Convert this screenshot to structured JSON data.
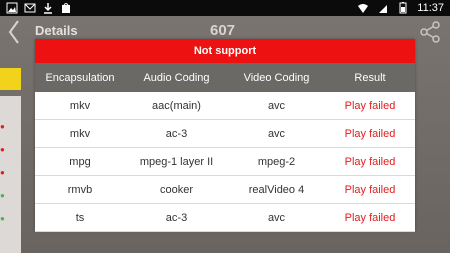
{
  "status_bar": {
    "time": "11:37",
    "left_icons": [
      "image-icon",
      "gmail-icon",
      "download-icon",
      "store-icon"
    ],
    "right_icons": [
      "wifi-icon",
      "sim-icon",
      "battery-icon"
    ]
  },
  "app": {
    "title": "Details",
    "number": "607"
  },
  "dialog": {
    "title": "Not support",
    "headers": [
      "Encapsulation",
      "Audio Coding",
      "Video Coding",
      "Result"
    ],
    "rows": [
      [
        "mkv",
        "aac(main)",
        "avc",
        "Play failed"
      ],
      [
        "mkv",
        "ac-3",
        "avc",
        "Play failed"
      ],
      [
        "mpg",
        "mpeg-1 layer II",
        "mpeg-2",
        "Play failed"
      ],
      [
        "rmvb",
        "cooker",
        "realVideo 4",
        "Play failed"
      ],
      [
        "ts",
        "ac-3",
        "avc",
        "Play failed"
      ]
    ]
  },
  "colors": {
    "accent_red": "#ee1111",
    "failed_red": "#e21d1d",
    "header_gray": "#6b6966",
    "overlay_brown": "#6f6965"
  }
}
